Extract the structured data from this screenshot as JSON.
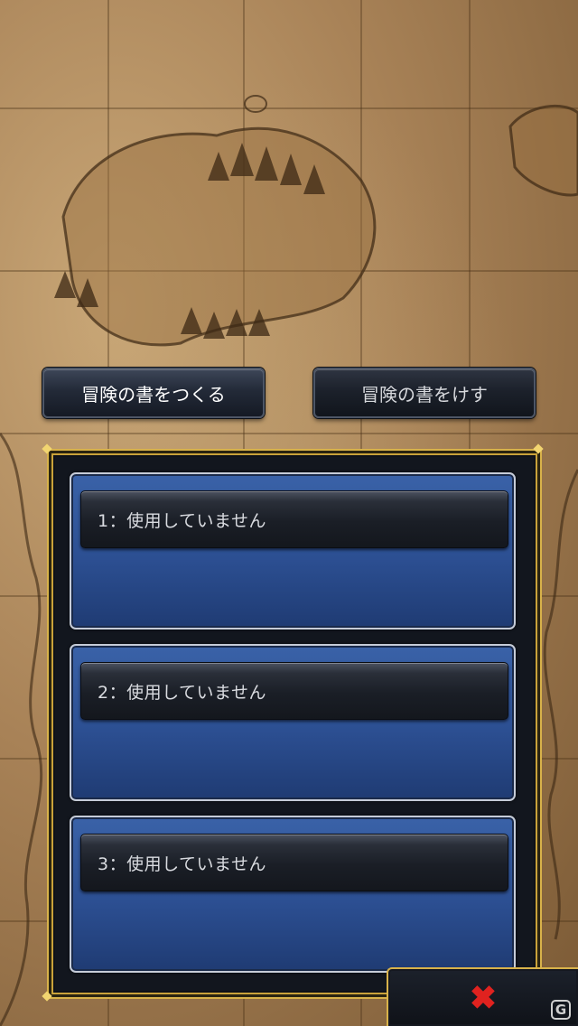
{
  "top_buttons": {
    "create_label": "冒険の書をつくる",
    "delete_label": "冒険の書をけす"
  },
  "slots": [
    {
      "label": "1：使用していません"
    },
    {
      "label": "2：使用していません"
    },
    {
      "label": "3：使用していません"
    }
  ],
  "close_button": {
    "icon": "close-icon",
    "glyph": "✖",
    "color": "#e0221f"
  },
  "watermark": {
    "glyph": "G"
  },
  "colors": {
    "slot_blue": "#2c4f92",
    "frame_gold": "#d8b24a",
    "parchment": "#a88257"
  }
}
